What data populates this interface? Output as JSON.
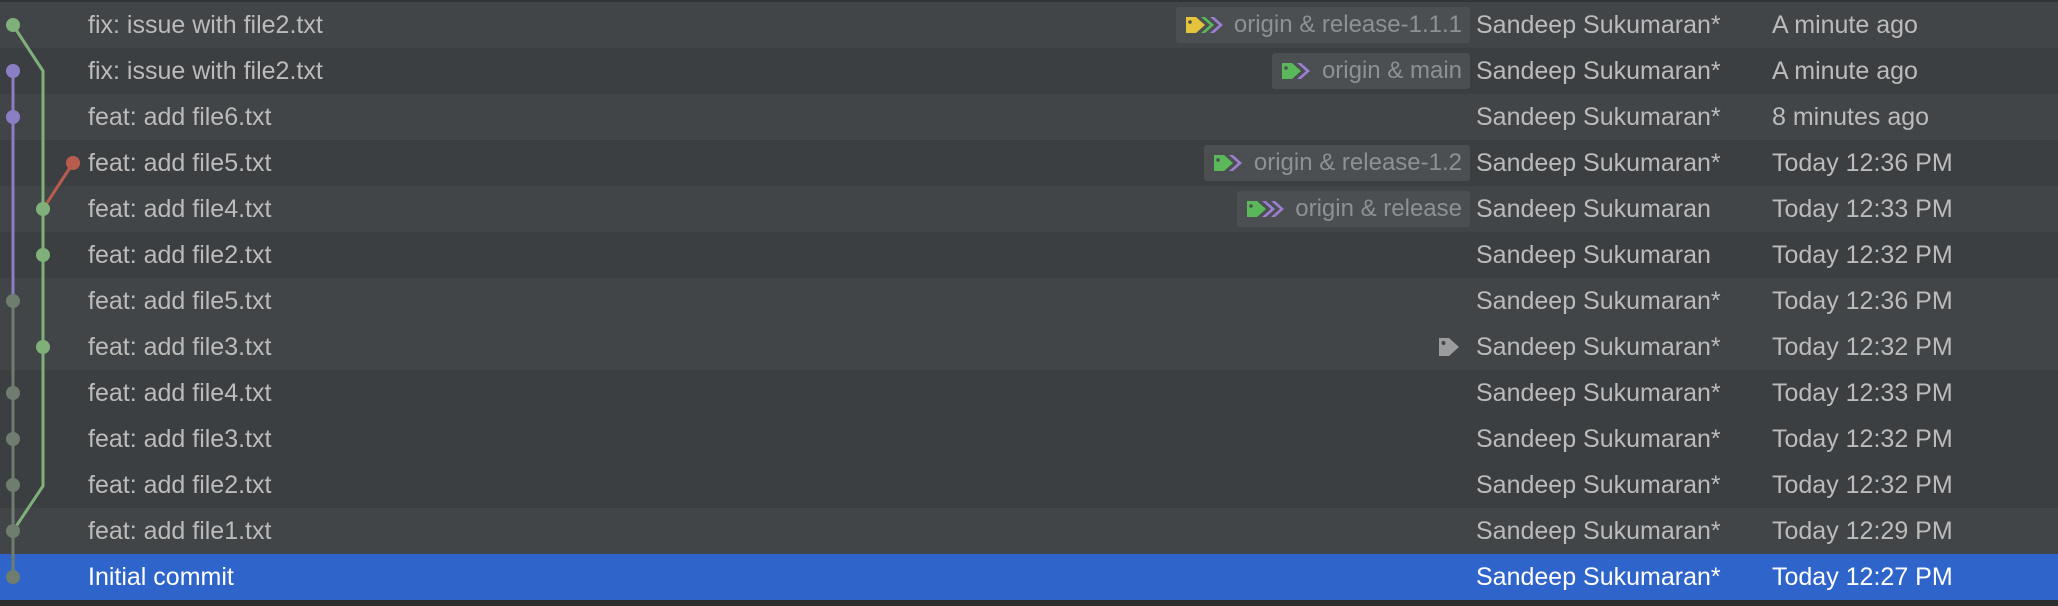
{
  "commits": [
    {
      "message": "fix: issue with file2.txt",
      "refs": "origin & release-1.1.1",
      "ref_icons": [
        "yellow-tag-icon",
        "green-tag-icon",
        "purple-tag-icon"
      ],
      "author": "Sandeep Sukumaran*",
      "date": "A minute ago"
    },
    {
      "message": "fix: issue with file2.txt",
      "refs": "origin & main",
      "ref_icons": [
        "green-tag-icon",
        "purple-tag-icon"
      ],
      "author": "Sandeep Sukumaran*",
      "date": "A minute ago"
    },
    {
      "message": "feat: add file6.txt",
      "refs": "",
      "ref_icons": [],
      "author": "Sandeep Sukumaran*",
      "date": "8 minutes ago"
    },
    {
      "message": "feat: add file5.txt",
      "refs": "origin & release-1.2",
      "ref_icons": [
        "green-tag-icon",
        "purple-tag-icon"
      ],
      "author": "Sandeep Sukumaran*",
      "date": "Today 12:36 PM"
    },
    {
      "message": "feat: add file4.txt",
      "refs": "origin & release",
      "ref_icons": [
        "green-tag-icon",
        "purple-tag-icon",
        "purple-tag-icon"
      ],
      "author": "Sandeep Sukumaran",
      "date": "Today 12:33 PM"
    },
    {
      "message": "feat: add file2.txt",
      "refs": "",
      "ref_icons": [],
      "author": "Sandeep Sukumaran",
      "date": "Today 12:32 PM"
    },
    {
      "message": "feat: add file5.txt",
      "refs": "",
      "ref_icons": [],
      "author": "Sandeep Sukumaran*",
      "date": "Today 12:36 PM"
    },
    {
      "message": "feat: add file3.txt",
      "refs": "",
      "ref_icons": [
        "gray-tag-icon"
      ],
      "author": "Sandeep Sukumaran*",
      "date": "Today 12:32 PM"
    },
    {
      "message": "feat: add file4.txt",
      "refs": "",
      "ref_icons": [],
      "author": "Sandeep Sukumaran*",
      "date": "Today 12:33 PM"
    },
    {
      "message": "feat: add file3.txt",
      "refs": "",
      "ref_icons": [],
      "author": "Sandeep Sukumaran*",
      "date": "Today 12:32 PM"
    },
    {
      "message": "feat: add file2.txt",
      "refs": "",
      "ref_icons": [],
      "author": "Sandeep Sukumaran*",
      "date": "Today 12:32 PM"
    },
    {
      "message": "feat: add file1.txt",
      "refs": "",
      "ref_icons": [],
      "author": "Sandeep Sukumaran*",
      "date": "Today 12:29 PM"
    },
    {
      "message": "Initial commit",
      "refs": "",
      "ref_icons": [],
      "author": "Sandeep Sukumaran*",
      "date": "Today 12:27 PM",
      "selected": true
    }
  ],
  "colors": {
    "background": "#3c3f41",
    "row_alt": "#414547",
    "selected": "#2f65ca",
    "text": "#bbbbbb",
    "ref_text": "#8e9193",
    "green_branch": "#7fb07a",
    "purple_branch": "#8a7fc4",
    "red_branch": "#b85c4f",
    "gray_branch": "#6f7d6f",
    "tag_yellow": "#e3c43a",
    "tag_green": "#5ab85a",
    "tag_purple": "#9b7fd0"
  }
}
